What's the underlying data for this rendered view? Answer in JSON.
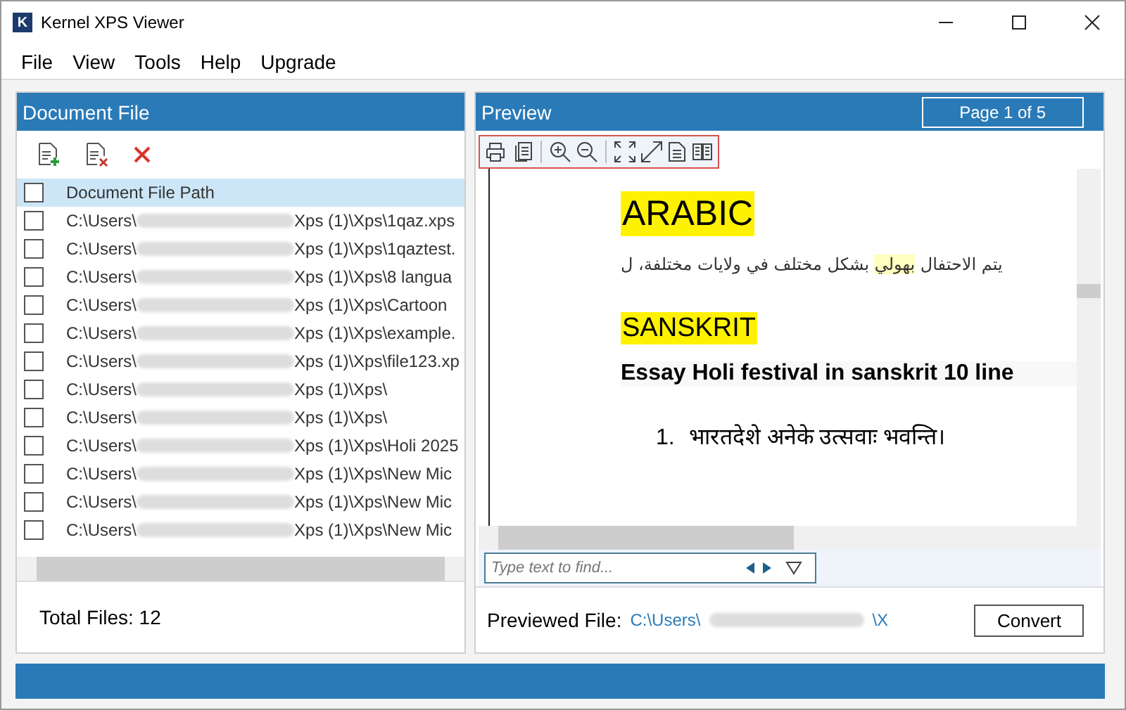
{
  "window": {
    "title": "Kernel XPS Viewer",
    "logo": "K"
  },
  "menu": [
    "File",
    "View",
    "Tools",
    "Help",
    "Upgrade"
  ],
  "document_panel": {
    "title": "Document File",
    "header": {
      "label": "Document File Path",
      "checked": false,
      "selected": true
    },
    "files": [
      {
        "prefix": "C:\\Users\\",
        "suffix": "Xps (1)\\Xps\\1qaz.xps",
        "checked": false
      },
      {
        "prefix": "C:\\Users\\",
        "suffix": "Xps (1)\\Xps\\1qaztest.",
        "checked": false
      },
      {
        "prefix": "C:\\Users\\",
        "suffix": "Xps (1)\\Xps\\8 langua",
        "checked": false
      },
      {
        "prefix": "C:\\Users\\",
        "suffix": "Xps (1)\\Xps\\Cartoon",
        "checked": false
      },
      {
        "prefix": "C:\\Users\\",
        "suffix": "Xps (1)\\Xps\\example.",
        "checked": false
      },
      {
        "prefix": "C:\\Users\\",
        "suffix": "Xps (1)\\Xps\\file123.xp",
        "checked": false
      },
      {
        "prefix": "C:\\Users\\",
        "suffix": "Xps (1)\\Xps\\",
        "checked": false
      },
      {
        "prefix": "C:\\Users\\",
        "suffix": "Xps (1)\\Xps\\",
        "checked": false
      },
      {
        "prefix": "C:\\Users\\",
        "suffix": "Xps (1)\\Xps\\Holi 2025",
        "checked": false
      },
      {
        "prefix": "C:\\Users\\",
        "suffix": "Xps (1)\\Xps\\New Mic",
        "checked": false
      },
      {
        "prefix": "C:\\Users\\",
        "suffix": "Xps (1)\\Xps\\New Mic",
        "checked": false
      },
      {
        "prefix": "C:\\Users\\",
        "suffix": "Xps (1)\\Xps\\New Mic",
        "checked": false
      }
    ],
    "total": "Total Files: 12"
  },
  "preview": {
    "title": "Preview",
    "page": "Page 1 of 5",
    "document": {
      "heading_1": "ARABIC",
      "arabic_line": [
        {
          "text": "يتم الاحتفال ",
          "highlight": false
        },
        {
          "text": "بهولي",
          "highlight": true
        },
        {
          "text": " بشكل مختلف في ولايات مختلفة، ل",
          "highlight": false
        }
      ],
      "heading_2": "SANSKRIT",
      "essay_title": "Essay Holi festival in sanskrit 10 line",
      "list_number": "1.",
      "list_item": "भारतदेशे अनेके उत्सवाः भवन्ति।"
    },
    "find": {
      "placeholder": "Type text to find..."
    },
    "previewed_label": "Previewed File:",
    "previewed_prefix": "C:\\Users\\",
    "previewed_suffix": "\\X",
    "convert": "Convert"
  }
}
